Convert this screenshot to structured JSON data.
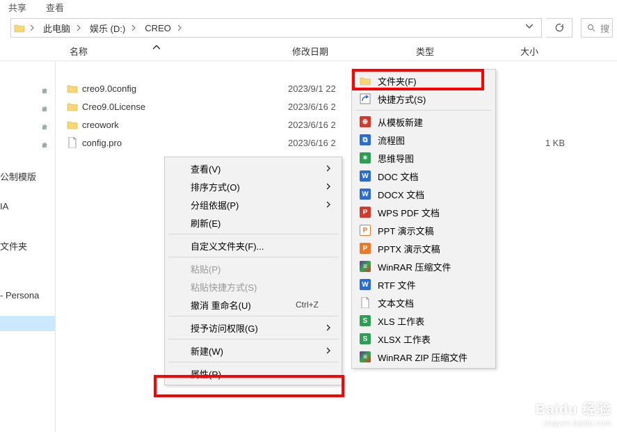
{
  "tabs": {
    "share": "共享",
    "view": "查看"
  },
  "breadcrumb": {
    "items": [
      "此电脑",
      "娱乐 (D:)",
      "CREO"
    ]
  },
  "search": {
    "placeholder": "搜"
  },
  "columns": {
    "name": "名称",
    "date": "修改日期",
    "type": "类型",
    "size": "大小"
  },
  "nav": {
    "pins": [
      "",
      "",
      "",
      ""
    ],
    "g0": "公制模版",
    "g1": "IA",
    "g2": "文件夹",
    "g3": "- Persona"
  },
  "files": [
    {
      "name": "creo9.0config",
      "date": "2023/9/1 22",
      "type": "",
      "size": "",
      "kind": "folder"
    },
    {
      "name": "Creo9.0License",
      "date": "2023/6/16 2",
      "type": "",
      "size": "",
      "kind": "folder"
    },
    {
      "name": "creowork",
      "date": "2023/6/16 2",
      "type": "",
      "size": "",
      "kind": "folder"
    },
    {
      "name": "config.pro",
      "date": "2023/6/16 2",
      "type": "",
      "size": "1 KB",
      "kind": "file"
    }
  ],
  "context1": {
    "view": "查看(V)",
    "sort": "排序方式(O)",
    "group": "分组依据(P)",
    "refresh": "刷新(E)",
    "custom": "自定义文件夹(F)...",
    "paste": "粘贴(P)",
    "paste_sc": "粘贴快捷方式(S)",
    "undo": "撤消 重命名(U)",
    "undo_key": "Ctrl+Z",
    "access": "授予访问权限(G)",
    "new": "新建(W)",
    "props": "属性(R)"
  },
  "context2": {
    "folder": "文件夹(F)",
    "shortcut": "快捷方式(S)",
    "tpl": "从模板新建",
    "flow": "流程图",
    "mind": "思维导图",
    "doc": "DOC 文档",
    "docx": "DOCX 文档",
    "wpspdf": "WPS PDF 文档",
    "ppt": "PPT 演示文稿",
    "pptx": "PPTX 演示文稿",
    "rar": "WinRAR 压缩文件",
    "rtf": "RTF 文件",
    "txt": "文本文档",
    "xls": "XLS 工作表",
    "xlsx": "XLSX 工作表",
    "zip": "WinRAR ZIP 压缩文件"
  },
  "icons": {
    "folder_color": "#F8D775",
    "folder_stroke": "#D9A93A",
    "wps_blue": "#2C6BD1",
    "wps_darkblue": "#1B3C8A",
    "wps_red": "#D23A2E",
    "wps_orange": "#E8792B",
    "wps_green": "#2E9E55",
    "rar_mix": "linear-gradient(135deg,#6a2fa8,#2fa84d,#d23a2e)"
  },
  "watermark": {
    "brand": "Baidu 经验",
    "sub": "jingyan.baidu.com"
  }
}
